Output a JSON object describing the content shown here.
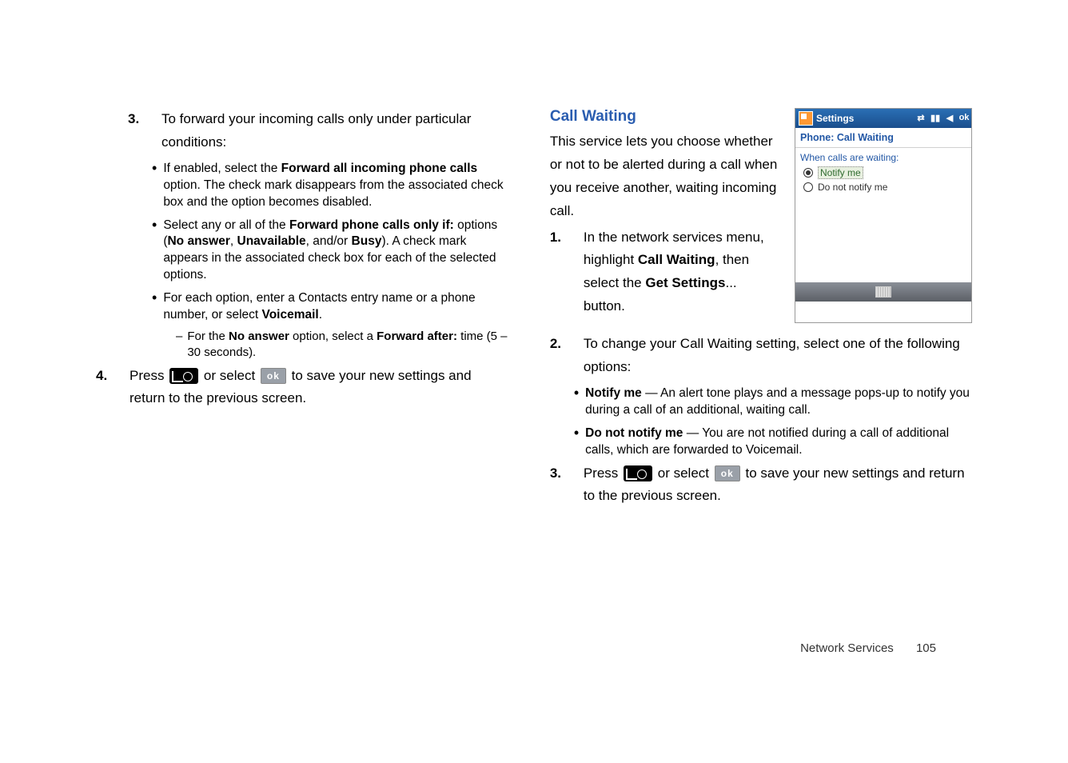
{
  "left": {
    "step3": {
      "num": "3.",
      "text": "To forward your incoming calls only under particular conditions:"
    },
    "b1": {
      "pre": "If enabled, select the ",
      "bold": "Forward all incoming phone calls",
      "post": " option. The check mark disappears from the associated check box and the option becomes disabled."
    },
    "b2": {
      "pre": "Select any or all of the ",
      "bold1": "Forward phone calls only if:",
      "mid1": " options (",
      "bold2": "No answer",
      "mid2": ", ",
      "bold3": "Unavailable",
      "mid3": ", and/or ",
      "bold4": "Busy",
      "post": "). A check mark appears in the associated check box for each of the selected options."
    },
    "b3": {
      "pre": "For each option, enter a Contacts entry name or a phone number, or select ",
      "bold": "Voicemail",
      "post": "."
    },
    "d1": {
      "dash": "–",
      "pre": "For the ",
      "bold1": "No answer",
      "mid": " option, select a ",
      "bold2": "Forward after:",
      "post": " time (5 – 30 seconds)."
    },
    "step4": {
      "num": "4.",
      "pre": "Press ",
      "mid": " or select ",
      "post": " to save your new settings and return to the previous screen."
    }
  },
  "right": {
    "heading": "Call Waiting",
    "intro": "This service lets you choose whether or not to be alerted during a call when you receive another, waiting incoming call.",
    "step1": {
      "num": "1.",
      "pre": "In the network services menu, highlight ",
      "bold1": "Call Waiting",
      "mid": ", then select the ",
      "bold2": "Get Settings",
      "post": "... button."
    },
    "step2": {
      "num": "2.",
      "text": "To change your Call Waiting setting, select one of the following options:"
    },
    "rb1": {
      "bold": "Notify me",
      "post": " — An alert tone plays and a message pops-up to notify you during a call of an additional, waiting call."
    },
    "rb2": {
      "bold": "Do not notify me",
      "post": " — You are not notified during a call of additional calls, which are forwarded to Voicemail."
    },
    "step3": {
      "num": "3.",
      "pre": "Press ",
      "mid": " or select ",
      "post": " to save your new settings and return to the previous screen."
    }
  },
  "phone": {
    "title": "Settings",
    "ok": "ok",
    "subhead": "Phone: Call Waiting",
    "whenlabel": "When calls are waiting:",
    "opt1": "Notify me",
    "opt2": "Do not notify me"
  },
  "icons": {
    "ok_label": "ok"
  },
  "footer": {
    "section": "Network Services",
    "page": "105"
  }
}
